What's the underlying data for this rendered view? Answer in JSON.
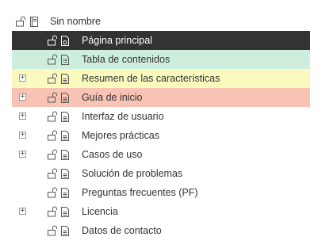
{
  "tree": {
    "root": {
      "label": "Sin nombre",
      "icons": [
        "unlock-icon",
        "book-icon"
      ]
    },
    "items": [
      {
        "label": "Página principal",
        "expandable": false,
        "highlight": "selected",
        "page_icon": "page-settings-icon"
      },
      {
        "label": "Tabla de contenidos",
        "expandable": false,
        "highlight": "green",
        "page_icon": "page-list-icon"
      },
      {
        "label": "Resumen de las características",
        "expandable": true,
        "highlight": "yellow",
        "page_icon": "page-icon"
      },
      {
        "label": "Guía de inicio",
        "expandable": true,
        "highlight": "red",
        "page_icon": "page-icon"
      },
      {
        "label": "Interfaz de usuario",
        "expandable": true,
        "highlight": "none",
        "page_icon": "page-icon"
      },
      {
        "label": "Mejores prácticas",
        "expandable": true,
        "highlight": "none",
        "page_icon": "page-icon"
      },
      {
        "label": "Casos de uso",
        "expandable": true,
        "highlight": "none",
        "page_icon": "page-icon"
      },
      {
        "label": "Solución de problemas",
        "expandable": false,
        "highlight": "none",
        "page_icon": "page-icon"
      },
      {
        "label": "Preguntas frecuentes (PF)",
        "expandable": false,
        "highlight": "none",
        "page_icon": "page-icon"
      },
      {
        "label": "Licencia",
        "expandable": true,
        "highlight": "none",
        "page_icon": "page-icon"
      },
      {
        "label": "Datos de contacto",
        "expandable": false,
        "highlight": "none",
        "page_icon": "page-icon"
      }
    ],
    "expand_symbol": "+"
  },
  "colors": {
    "selected": "#333333",
    "green": "#cdeedd",
    "yellow": "#fafabe",
    "red": "#f8c2b5"
  }
}
